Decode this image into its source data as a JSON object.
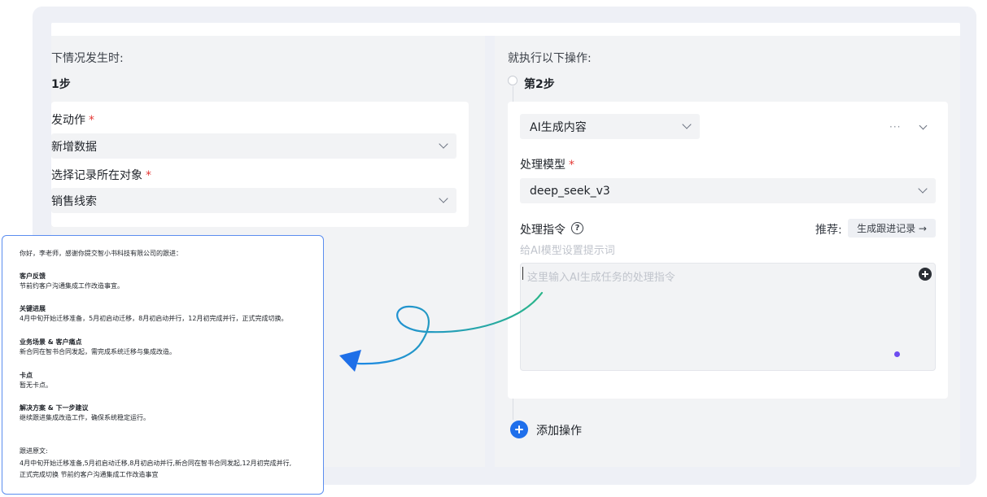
{
  "left": {
    "section_title": "下情况发生时:",
    "step_title": "1步",
    "trigger_label": "发动作",
    "trigger_value": "新增数据",
    "object_label": "选择记录所在对象",
    "object_value": "销售线索"
  },
  "right": {
    "section_title": "就执行以下操作:",
    "step_title": "第2步",
    "action_value": "AI生成内容",
    "more_icon": "···",
    "model_label": "处理模型",
    "model_value": "deep_seek_v3",
    "instruction_label": "处理指令",
    "help_icon_glyph": "?",
    "recommend_label": "推荐:",
    "recommend_button": "生成跟进记录 →",
    "hint": "给AI模型设置提示词",
    "textarea_placeholder": "这里输入AI生成任务的处理指令",
    "add_operation": "添加操作"
  },
  "required_mark": "*",
  "doc": {
    "greeting": "你好，李老师，感谢你提交智小书科技有限公司的跟进：",
    "sections": [
      {
        "heading": "客户反馈",
        "body": "节前约客户沟通集成工作改造事宜。"
      },
      {
        "heading": "关键进展",
        "body": "4月中旬开始迁移准备，5月初启动迁移，8月初启动并行，12月初完成并行，正式完成切换。"
      },
      {
        "heading": "业务场景 & 客户痛点",
        "body": "新合同在智书合同发起，需完成系统迁移与集成改造。"
      },
      {
        "heading": "卡点",
        "body": "暂无卡点。"
      },
      {
        "heading": "解决方案 & 下一步建议",
        "body": "继续跟进集成改造工作，确保系统稳定运行。"
      }
    ],
    "original_label": "跟进原文:",
    "original_line1": "4月中旬开始迁移准备,5月初启动迁移,8月初启动并行,新合同在智书合同发起,12月初完成并行,",
    "original_line2": "正式完成切换 节前约客户沟通集成工作改造事宜"
  },
  "colors": {
    "accent_blue": "#1f6feb",
    "arrow_teal": "#2bb58a",
    "arrow_blue": "#1e88e5",
    "required_red": "#e53935"
  }
}
